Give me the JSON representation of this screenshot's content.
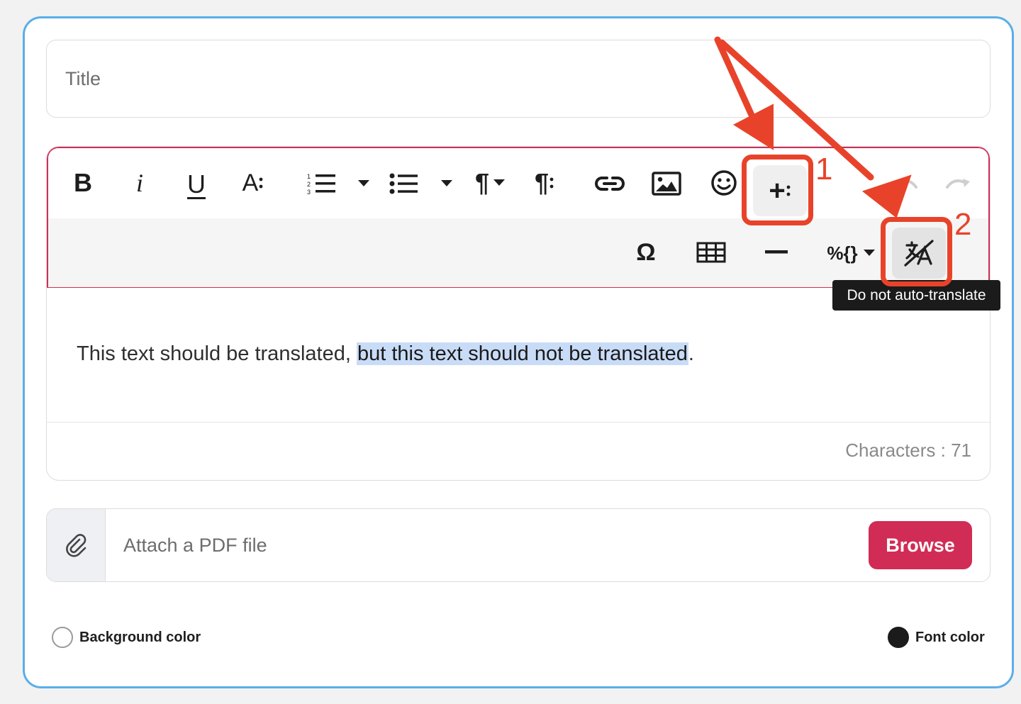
{
  "form": {
    "title_placeholder": "Title",
    "content_plain": "This text should be translated, ",
    "content_highlighted": "but this text should not be translated",
    "content_end": ".",
    "character_count": "Characters : 71",
    "attach_placeholder": "Attach a PDF file",
    "browse_label": "Browse",
    "background_color_label": "Background color",
    "font_color_label": "Font color"
  },
  "toolbar": {
    "row1": [
      {
        "name": "bold-button",
        "icon": "bold-icon",
        "glyph": "B"
      },
      {
        "name": "italic-button",
        "icon": "italic-icon",
        "glyph": "i"
      },
      {
        "name": "underline-button",
        "icon": "underline-icon",
        "glyph": "U"
      },
      {
        "name": "font-size-button",
        "icon": "font-size-icon",
        "glyph": "A"
      },
      {
        "name": "ordered-list-button",
        "icon": "ordered-list-icon"
      },
      {
        "name": "unordered-list-button",
        "icon": "unordered-list-icon"
      },
      {
        "name": "paragraph-format-button",
        "icon": "paragraph-icon",
        "glyph": "¶"
      },
      {
        "name": "paragraph-style-button",
        "icon": "paragraph-style-icon",
        "glyph": "¶"
      },
      {
        "name": "insert-link-button",
        "icon": "link-icon"
      },
      {
        "name": "insert-image-button",
        "icon": "image-icon"
      },
      {
        "name": "emoticons-button",
        "icon": "smiley-icon"
      },
      {
        "name": "more-insert-button",
        "icon": "plus-more-icon",
        "glyph": "+"
      },
      {
        "name": "undo-button",
        "icon": "undo-icon"
      },
      {
        "name": "redo-button",
        "icon": "redo-icon"
      }
    ],
    "row2": [
      {
        "name": "special-characters-button",
        "icon": "omega-icon",
        "glyph": "Ω"
      },
      {
        "name": "insert-table-button",
        "icon": "table-icon"
      },
      {
        "name": "horizontal-line-button",
        "icon": "horizontal-line-icon"
      },
      {
        "name": "placeholders-button",
        "icon": "placeholder-icon",
        "glyph": "%{}"
      },
      {
        "name": "do-not-translate-button",
        "icon": "no-translate-icon"
      }
    ],
    "tooltip": "Do not auto-translate"
  },
  "annotations": {
    "label_1": "1",
    "label_2": "2",
    "color": "#e8432a"
  },
  "colors": {
    "card_border": "#5aaee8",
    "toolbar_accent": "#cf2f56",
    "browse_button": "#d12c55",
    "selection_highlight": "#c9dcf7",
    "font_color_swatch": "#1b1b1b",
    "background_color_swatch": "#ffffff"
  }
}
